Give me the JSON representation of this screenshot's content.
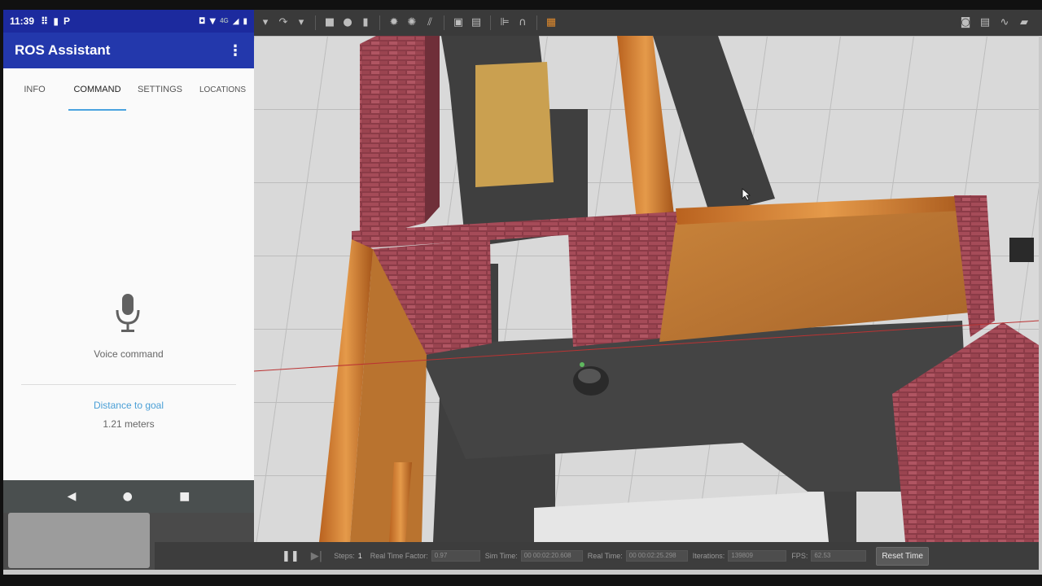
{
  "phone": {
    "status": {
      "time": "11:39",
      "network": "4G"
    },
    "app_title": "ROS Assistant",
    "tabs": [
      {
        "label": "INFO"
      },
      {
        "label": "COMMAND",
        "active": true
      },
      {
        "label": "SETTINGS"
      },
      {
        "label": "LOCATIONS"
      }
    ],
    "voice_label": "Voice command",
    "distance_label": "Distance to goal",
    "distance_value": "1.21 meters"
  },
  "sim": {
    "steps_label": "Steps:",
    "steps_value": "1",
    "rtf_label": "Real Time Factor:",
    "rtf_value": "0.97",
    "sim_time_label": "Sim Time:",
    "sim_time_value": "00 00:02:20.608",
    "real_time_label": "Real Time:",
    "real_time_value": "00 00:02:25.298",
    "iterations_label": "Iterations:",
    "iterations_value": "139809",
    "fps_label": "FPS:",
    "fps_value": "62.53",
    "reset_label": "Reset Time"
  },
  "colors": {
    "app_bar": "#2338ac",
    "status_bar": "#1c2a9e",
    "accent": "#4aa3df"
  }
}
